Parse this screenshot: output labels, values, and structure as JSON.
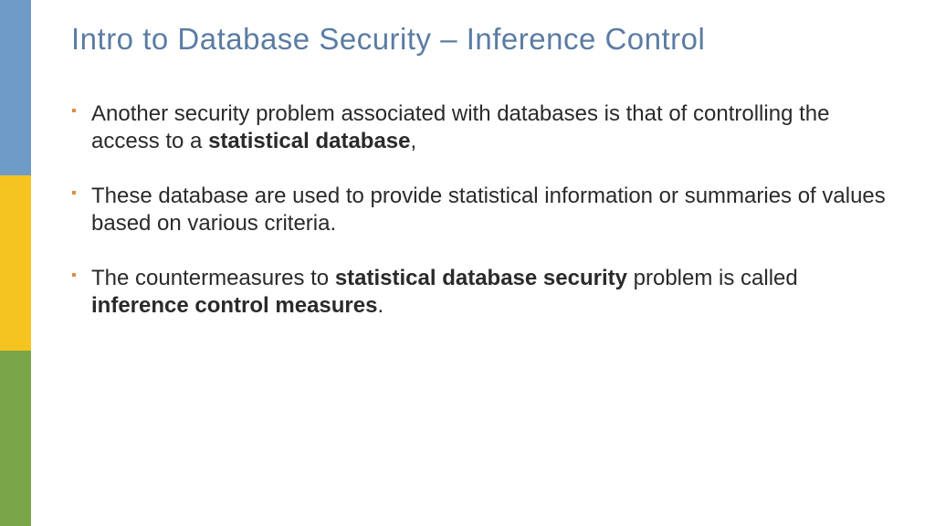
{
  "sidebar": {
    "colors": [
      "#6f9bc9",
      "#f6c420",
      "#7aa448"
    ]
  },
  "title": "Intro to Database Security – Inference Control",
  "bullets": [
    {
      "pre": "Another security problem associated with databases is that of controlling the access to a ",
      "bold1": "statistical database",
      "post": ","
    },
    {
      "pre": "These database are used to provide statistical information or summaries of values based on various criteria.",
      "bold1": "",
      "post": ""
    },
    {
      "pre": "The countermeasures to ",
      "bold1": "statistical database security",
      "mid": " problem is called ",
      "bold2": "inference control measures",
      "post": "."
    }
  ]
}
